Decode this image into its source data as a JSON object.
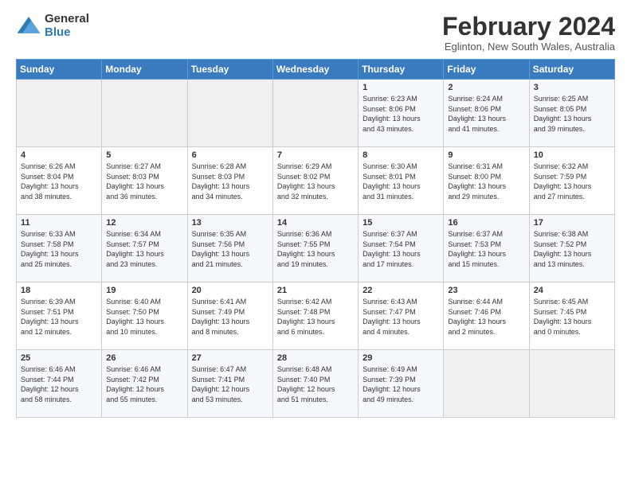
{
  "header": {
    "logo_general": "General",
    "logo_blue": "Blue",
    "month_year": "February 2024",
    "location": "Eglinton, New South Wales, Australia"
  },
  "calendar": {
    "days_of_week": [
      "Sunday",
      "Monday",
      "Tuesday",
      "Wednesday",
      "Thursday",
      "Friday",
      "Saturday"
    ],
    "weeks": [
      [
        {
          "day": "",
          "info": ""
        },
        {
          "day": "",
          "info": ""
        },
        {
          "day": "",
          "info": ""
        },
        {
          "day": "",
          "info": ""
        },
        {
          "day": "1",
          "info": "Sunrise: 6:23 AM\nSunset: 8:06 PM\nDaylight: 13 hours\nand 43 minutes."
        },
        {
          "day": "2",
          "info": "Sunrise: 6:24 AM\nSunset: 8:06 PM\nDaylight: 13 hours\nand 41 minutes."
        },
        {
          "day": "3",
          "info": "Sunrise: 6:25 AM\nSunset: 8:05 PM\nDaylight: 13 hours\nand 39 minutes."
        }
      ],
      [
        {
          "day": "4",
          "info": "Sunrise: 6:26 AM\nSunset: 8:04 PM\nDaylight: 13 hours\nand 38 minutes."
        },
        {
          "day": "5",
          "info": "Sunrise: 6:27 AM\nSunset: 8:03 PM\nDaylight: 13 hours\nand 36 minutes."
        },
        {
          "day": "6",
          "info": "Sunrise: 6:28 AM\nSunset: 8:03 PM\nDaylight: 13 hours\nand 34 minutes."
        },
        {
          "day": "7",
          "info": "Sunrise: 6:29 AM\nSunset: 8:02 PM\nDaylight: 13 hours\nand 32 minutes."
        },
        {
          "day": "8",
          "info": "Sunrise: 6:30 AM\nSunset: 8:01 PM\nDaylight: 13 hours\nand 31 minutes."
        },
        {
          "day": "9",
          "info": "Sunrise: 6:31 AM\nSunset: 8:00 PM\nDaylight: 13 hours\nand 29 minutes."
        },
        {
          "day": "10",
          "info": "Sunrise: 6:32 AM\nSunset: 7:59 PM\nDaylight: 13 hours\nand 27 minutes."
        }
      ],
      [
        {
          "day": "11",
          "info": "Sunrise: 6:33 AM\nSunset: 7:58 PM\nDaylight: 13 hours\nand 25 minutes."
        },
        {
          "day": "12",
          "info": "Sunrise: 6:34 AM\nSunset: 7:57 PM\nDaylight: 13 hours\nand 23 minutes."
        },
        {
          "day": "13",
          "info": "Sunrise: 6:35 AM\nSunset: 7:56 PM\nDaylight: 13 hours\nand 21 minutes."
        },
        {
          "day": "14",
          "info": "Sunrise: 6:36 AM\nSunset: 7:55 PM\nDaylight: 13 hours\nand 19 minutes."
        },
        {
          "day": "15",
          "info": "Sunrise: 6:37 AM\nSunset: 7:54 PM\nDaylight: 13 hours\nand 17 minutes."
        },
        {
          "day": "16",
          "info": "Sunrise: 6:37 AM\nSunset: 7:53 PM\nDaylight: 13 hours\nand 15 minutes."
        },
        {
          "day": "17",
          "info": "Sunrise: 6:38 AM\nSunset: 7:52 PM\nDaylight: 13 hours\nand 13 minutes."
        }
      ],
      [
        {
          "day": "18",
          "info": "Sunrise: 6:39 AM\nSunset: 7:51 PM\nDaylight: 13 hours\nand 12 minutes."
        },
        {
          "day": "19",
          "info": "Sunrise: 6:40 AM\nSunset: 7:50 PM\nDaylight: 13 hours\nand 10 minutes."
        },
        {
          "day": "20",
          "info": "Sunrise: 6:41 AM\nSunset: 7:49 PM\nDaylight: 13 hours\nand 8 minutes."
        },
        {
          "day": "21",
          "info": "Sunrise: 6:42 AM\nSunset: 7:48 PM\nDaylight: 13 hours\nand 6 minutes."
        },
        {
          "day": "22",
          "info": "Sunrise: 6:43 AM\nSunset: 7:47 PM\nDaylight: 13 hours\nand 4 minutes."
        },
        {
          "day": "23",
          "info": "Sunrise: 6:44 AM\nSunset: 7:46 PM\nDaylight: 13 hours\nand 2 minutes."
        },
        {
          "day": "24",
          "info": "Sunrise: 6:45 AM\nSunset: 7:45 PM\nDaylight: 13 hours\nand 0 minutes."
        }
      ],
      [
        {
          "day": "25",
          "info": "Sunrise: 6:46 AM\nSunset: 7:44 PM\nDaylight: 12 hours\nand 58 minutes."
        },
        {
          "day": "26",
          "info": "Sunrise: 6:46 AM\nSunset: 7:42 PM\nDaylight: 12 hours\nand 55 minutes."
        },
        {
          "day": "27",
          "info": "Sunrise: 6:47 AM\nSunset: 7:41 PM\nDaylight: 12 hours\nand 53 minutes."
        },
        {
          "day": "28",
          "info": "Sunrise: 6:48 AM\nSunset: 7:40 PM\nDaylight: 12 hours\nand 51 minutes."
        },
        {
          "day": "29",
          "info": "Sunrise: 6:49 AM\nSunset: 7:39 PM\nDaylight: 12 hours\nand 49 minutes."
        },
        {
          "day": "",
          "info": ""
        },
        {
          "day": "",
          "info": ""
        }
      ]
    ]
  }
}
